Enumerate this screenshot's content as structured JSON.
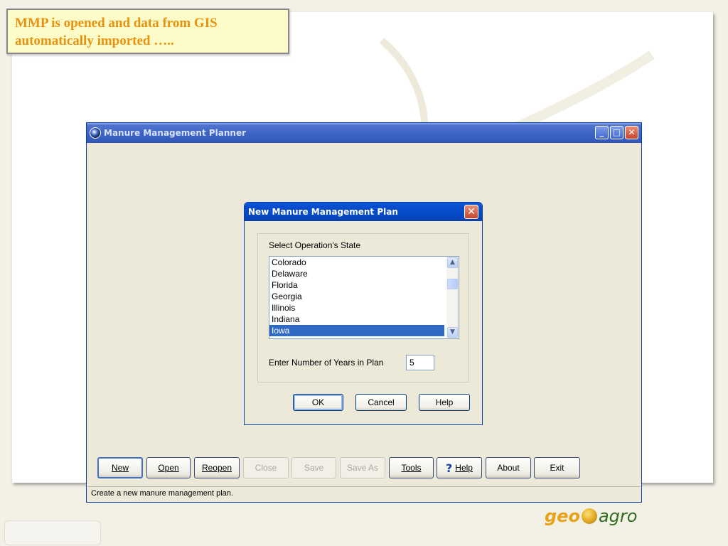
{
  "callout": {
    "line1": "MMP is opened and data from GIS",
    "line2": "automatically imported ….."
  },
  "main_window": {
    "title": "Manure Management Planner",
    "controls": {
      "minimize": "_",
      "maximize": "□",
      "close": "✕"
    }
  },
  "dialog": {
    "title": "New Manure Management Plan",
    "close_glyph": "✕",
    "state_label": "Select Operation's State",
    "states": [
      "Colorado",
      "Delaware",
      "Florida",
      "Georgia",
      "Illinois",
      "Indiana",
      "Iowa"
    ],
    "selected_state": "Iowa",
    "years_label": "Enter Number of Years in Plan",
    "years_value": "5",
    "buttons": {
      "ok": "OK",
      "cancel": "Cancel",
      "help": "Help"
    }
  },
  "toolbar": {
    "new": "New",
    "open": "Open",
    "reopen": "Reopen",
    "close": "Close",
    "save": "Save",
    "save_as": "Save As",
    "tools": "Tools",
    "help": "Help",
    "about": "About",
    "exit": "Exit"
  },
  "status": {
    "text": "Create a new manure management plan."
  },
  "logo": {
    "left": "geo",
    "right": "agro"
  }
}
